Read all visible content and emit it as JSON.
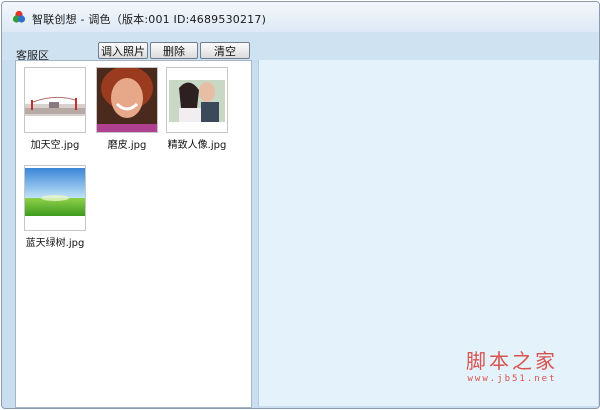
{
  "window": {
    "title": "智联创想 - 调色（版本:001   ID:4689530217)"
  },
  "toolbar": {
    "area_label": "客服区",
    "import_label": "调入照片",
    "delete_label": "删除",
    "clear_label": "清空"
  },
  "photos": [
    {
      "name": "加天空.jpg"
    },
    {
      "name": "磨皮.jpg"
    },
    {
      "name": "精致人像.jpg"
    },
    {
      "name": "蓝天绿树.jpg"
    }
  ],
  "watermark": {
    "main": "脚本之家",
    "sub": "www.jb51.net"
  },
  "colors": {
    "accent": "#cfe2f2",
    "preview_bg": "#e4f2fb",
    "watermark": "#d9534f"
  }
}
